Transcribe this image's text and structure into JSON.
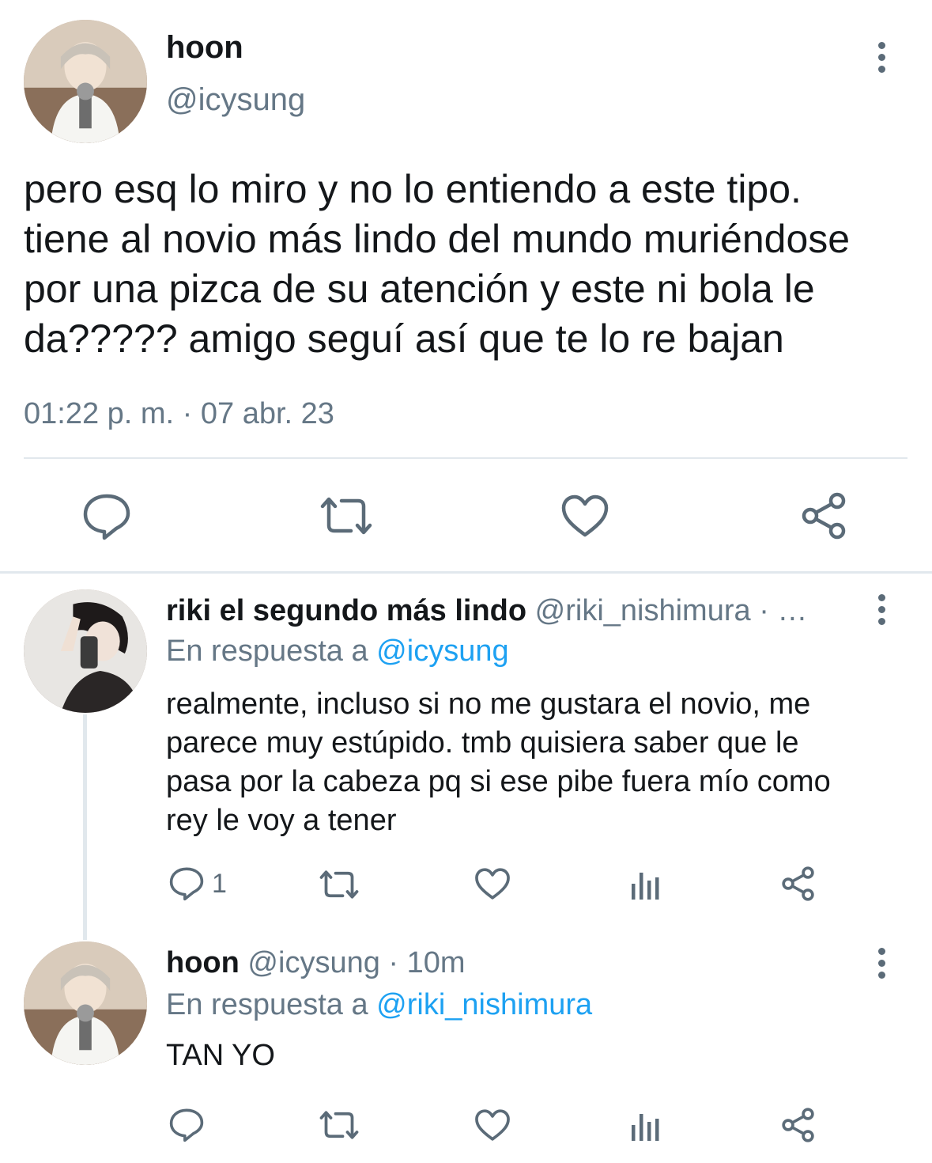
{
  "main_tweet": {
    "display_name": "hoon",
    "handle": "@icysung",
    "text_lines": [
      "pero esq lo miro y no lo entiendo a este tipo.",
      "tiene al novio más lindo del mundo muriéndose",
      "por una pizca de su atención y este ni bola le",
      "da????? amigo seguí así que te lo re bajan"
    ],
    "timestamp": "01:22 p. m. · 07 abr. 23",
    "actions": [
      "reply-icon",
      "retweet-icon",
      "like-icon",
      "share-icon"
    ]
  },
  "reply1": {
    "display_name": "riki el segundo más lindo",
    "handle_meta": "@riki_nishimura · …",
    "reply_prefix": "En respuesta a",
    "reply_to": "@icysung",
    "text_lines": [
      "realmente, incluso si no me gustara el novio, me",
      "parece muy estúpido. tmb quisiera saber que le",
      "pasa por la cabeza pq si ese pibe fuera mío como",
      "rey le voy a tener"
    ],
    "reply_count": "1",
    "actions": [
      "reply-icon",
      "retweet-icon",
      "like-icon",
      "analytics-icon",
      "share-icon"
    ]
  },
  "reply2": {
    "display_name": "hoon",
    "handle_meta": "@icysung · 10m",
    "reply_prefix": "En respuesta a",
    "reply_to": "@riki_nishimura",
    "text": "TAN YO",
    "actions": [
      "reply-icon",
      "retweet-icon",
      "like-icon",
      "analytics-icon",
      "share-icon"
    ]
  },
  "colors": {
    "text": "#14171a",
    "muted": "#657786",
    "link": "#1da1f2",
    "icon": "#5b6b78",
    "divider": "#e1e8ed"
  }
}
